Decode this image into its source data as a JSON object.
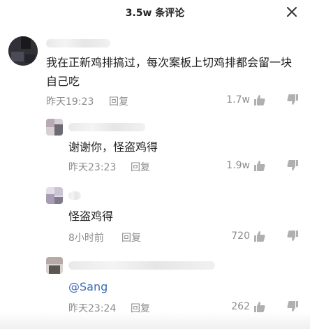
{
  "header": {
    "title": "3.5w 条评论"
  },
  "comments": [
    {
      "text": "我在正新鸡排搞过，每次案板上切鸡排都会留一块自己吃",
      "time": "昨天19:23",
      "reply_label": "回复",
      "likes": "1.7w"
    },
    {
      "text": "谢谢你，怪盗鸡得",
      "time": "昨天23:23",
      "reply_label": "回复",
      "likes": "1.9w"
    },
    {
      "text": "怪盗鸡得",
      "time": "8小时前",
      "reply_label": "回复",
      "likes": "720"
    },
    {
      "text": "@Sang",
      "time": "昨天23:24",
      "reply_label": "回复",
      "likes": "262"
    }
  ],
  "icons": {
    "close": "close-icon",
    "like": "thumbs-up-icon",
    "dislike": "thumbs-down-icon"
  }
}
